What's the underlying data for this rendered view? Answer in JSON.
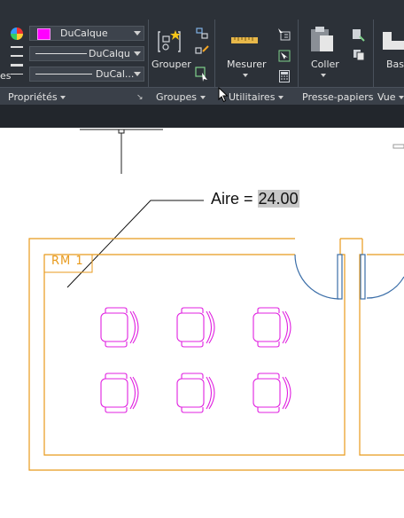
{
  "ribbon": {
    "proprietes": {
      "color_value": "DuCalque",
      "linetype_value": "DuCalqu",
      "lineweight_value": "DuCal...",
      "panel_label": "Propriétés",
      "left_clip": "es",
      "color_swatch": "#ff00ff"
    },
    "groupes": {
      "grouper_label": "Grouper",
      "panel_label": "Groupes"
    },
    "utilitaires": {
      "mesurer_label": "Mesurer",
      "panel_label": "Utilitaires"
    },
    "presse_papiers": {
      "coller_label": "Coller",
      "panel_label": "Presse-papiers"
    },
    "vue": {
      "base_label": "Base",
      "panel_label": "Vue"
    }
  },
  "drawing": {
    "aire_label": "Aire = ",
    "aire_value": "24.00",
    "room_tag": "RM  1",
    "colors": {
      "walls": "#e89a1c",
      "chairs": "#e020e0",
      "doors": "#3b6ea8",
      "leader": "#111111"
    }
  }
}
